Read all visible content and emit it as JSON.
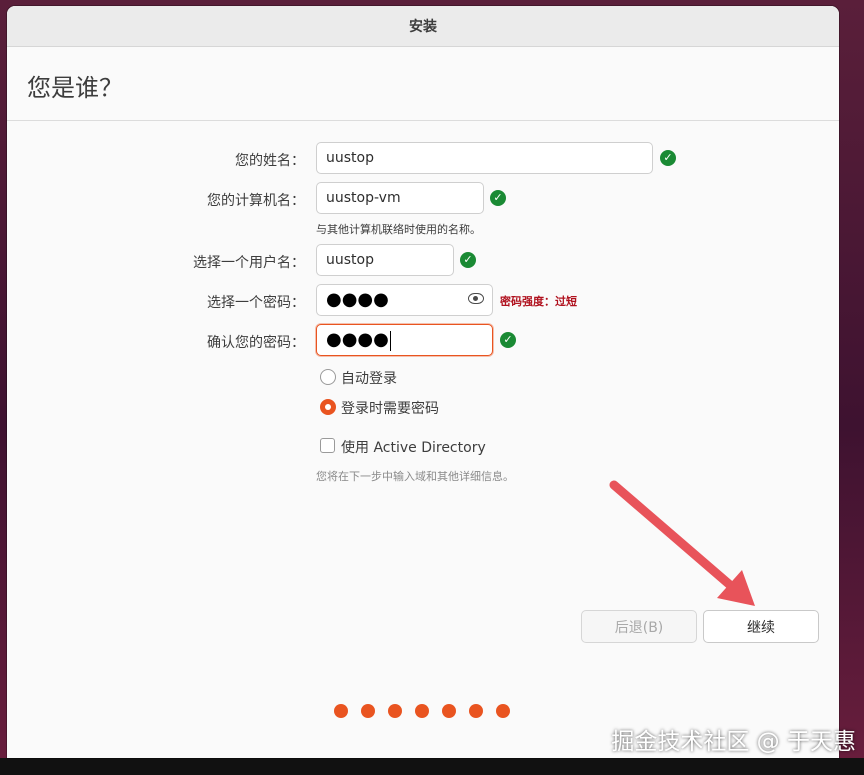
{
  "window": {
    "title": "安装"
  },
  "page": {
    "title": "您是谁？"
  },
  "form": {
    "name_label": "您的姓名：",
    "name_value": "uustop",
    "computer_label": "您的计算机名：",
    "computer_value": "uustop-vm",
    "computer_hint": "与其他计算机联络时使用的名称。",
    "username_label": "选择一个用户名：",
    "username_value": "uustop",
    "password_label": "选择一个密码：",
    "password_value": "●●●●",
    "password_strength": "密码强度：过短",
    "confirm_label": "确认您的密码：",
    "confirm_value": "●●●●"
  },
  "login_options": {
    "auto_login": "自动登录",
    "require_password": "登录时需要密码",
    "selected": "require_password"
  },
  "active_directory": {
    "label": "使用 Active Directory",
    "checked": false,
    "hint": "您将在下一步中输入域和其他详细信息。"
  },
  "buttons": {
    "back": "后退(B)",
    "continue": "继续"
  },
  "progress": {
    "total_steps": 7
  },
  "annotation": {
    "watermark": "掘金技术社区 @ 于天惠"
  },
  "colors": {
    "accent": "#e95420",
    "valid": "#1a8a34",
    "error": "#b0111e",
    "arrow": "#e8535a"
  }
}
